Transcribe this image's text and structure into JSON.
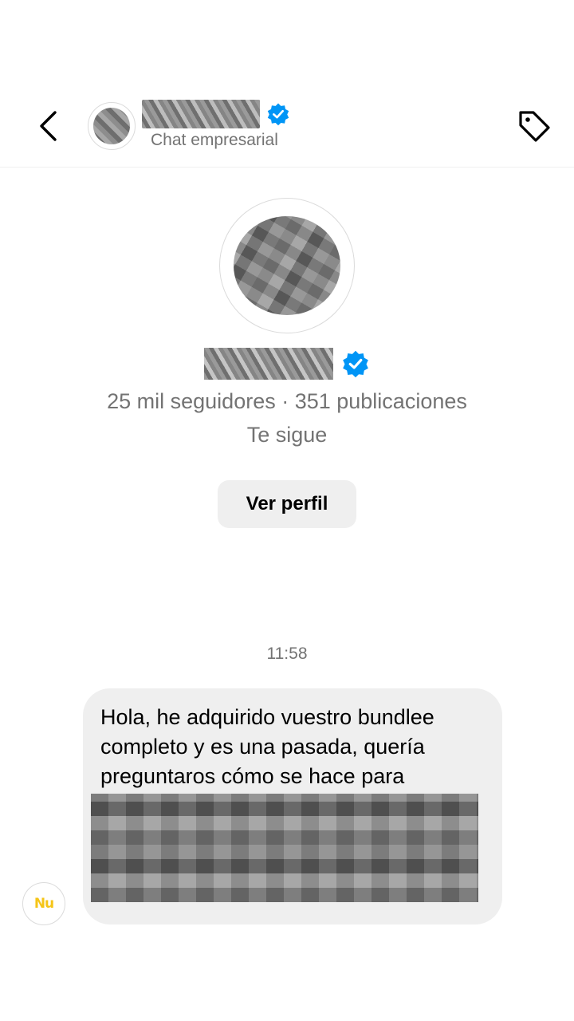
{
  "header": {
    "subtitle": "Chat empresarial",
    "back_icon": "chevron-left-icon",
    "tag_icon": "tag-icon",
    "verified_color": "#0095f6"
  },
  "profile": {
    "stats": "25 mil seguidores · 351 publicaciones",
    "follows_status": "Te sigue",
    "view_profile_label": "Ver perfil"
  },
  "conversation": {
    "timestamp": "11:58",
    "messages": [
      {
        "text": "Hola, he adquirido vuestro bundlee completo y es una pasada, quería preguntaros cómo se hace para",
        "bubble_color": "#efefef"
      }
    ],
    "sender_logo": "Nu"
  }
}
